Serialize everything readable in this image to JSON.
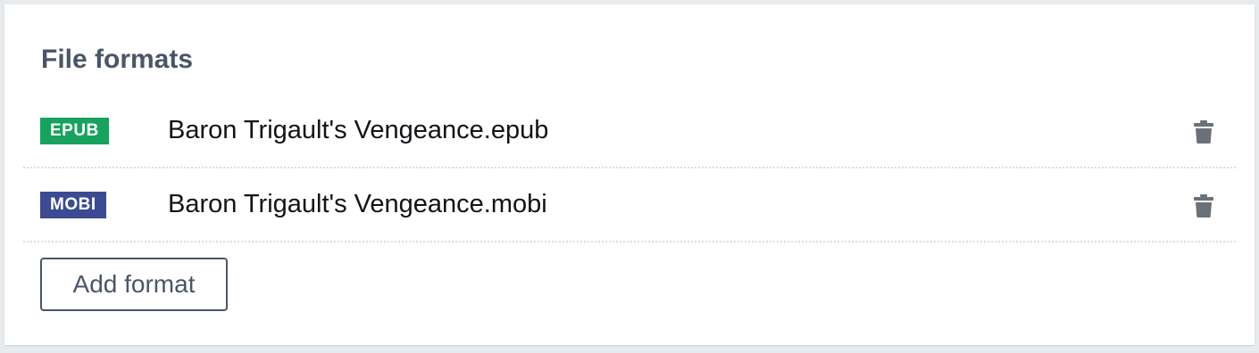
{
  "section": {
    "title": "File formats"
  },
  "formats": [
    {
      "badge": "EPUB",
      "badge_color": "#17a35e",
      "file_name": "Baron Trigault's Vengeance.epub",
      "action_icon": "trash-icon"
    },
    {
      "badge": "MOBI",
      "badge_color": "#3b4a91",
      "file_name": "Baron Trigault's Vengeance.mobi",
      "action_icon": "trash-icon"
    }
  ],
  "add_button": {
    "label": "Add format"
  },
  "colors": {
    "title": "#4a5568",
    "icon": "#6b7178",
    "divider": "#dadde1"
  }
}
